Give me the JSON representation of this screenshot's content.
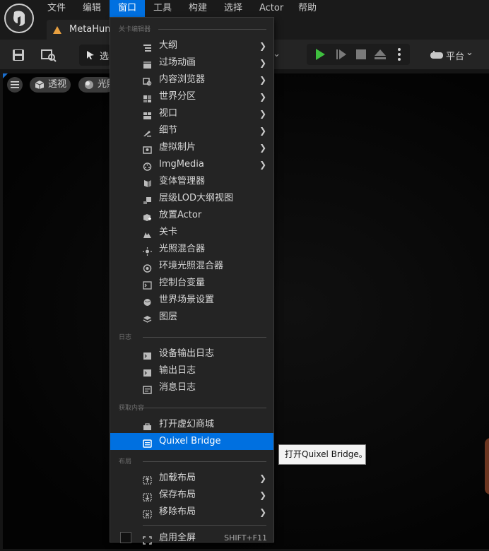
{
  "menubar": {
    "items": [
      "文件",
      "编辑",
      "窗口",
      "工具",
      "构建",
      "选择",
      "Actor",
      "帮助"
    ]
  },
  "document_tab": {
    "label": "MetaHuma"
  },
  "toolbar": {
    "select_mode_label": "选",
    "platform_label": "平台"
  },
  "viewport": {
    "perspective_label": "透视",
    "lighting_label": "光照"
  },
  "window_menu": {
    "sections": [
      {
        "title": "关卡编辑器",
        "items": [
          {
            "label": "大纲",
            "icon": "outliner-icon",
            "submenu": true
          },
          {
            "label": "过场动画",
            "icon": "cinematics-icon",
            "submenu": true
          },
          {
            "label": "内容浏览器",
            "icon": "content-browser-icon",
            "submenu": true
          },
          {
            "label": "世界分区",
            "icon": "world-partition-icon",
            "submenu": true
          },
          {
            "label": "视口",
            "icon": "viewport-icon",
            "submenu": true
          },
          {
            "label": "细节",
            "icon": "details-icon",
            "submenu": true
          },
          {
            "label": "虚拟制片",
            "icon": "virtual-production-icon",
            "submenu": true
          },
          {
            "label": "ImgMedia",
            "icon": "img-media-icon",
            "submenu": true
          },
          {
            "label": "变体管理器",
            "icon": "variant-manager-icon",
            "submenu": false
          },
          {
            "label": "层级LOD大纲视图",
            "icon": "hlod-outliner-icon",
            "submenu": false
          },
          {
            "label": "放置Actor",
            "icon": "place-actor-icon",
            "submenu": false
          },
          {
            "label": "关卡",
            "icon": "levels-icon",
            "submenu": false
          },
          {
            "label": "光照混合器",
            "icon": "light-mixer-icon",
            "submenu": false
          },
          {
            "label": "环境光照混合器",
            "icon": "env-light-mixer-icon",
            "submenu": false
          },
          {
            "label": "控制台变量",
            "icon": "console-variables-icon",
            "submenu": false
          },
          {
            "label": "世界场景设置",
            "icon": "world-settings-icon",
            "submenu": false
          },
          {
            "label": "图层",
            "icon": "layers-icon",
            "submenu": false
          }
        ]
      },
      {
        "title": "日志",
        "items": [
          {
            "label": "设备输出日志",
            "icon": "device-log-icon",
            "submenu": false
          },
          {
            "label": "输出日志",
            "icon": "output-log-icon",
            "submenu": false
          },
          {
            "label": "消息日志",
            "icon": "message-log-icon",
            "submenu": false
          }
        ]
      },
      {
        "title": "获取内容",
        "items": [
          {
            "label": "打开虚幻商城",
            "icon": "marketplace-icon",
            "submenu": false
          },
          {
            "label": "Quixel Bridge",
            "icon": "quixel-bridge-icon",
            "submenu": false,
            "highlighted": true
          }
        ]
      },
      {
        "title": "布局",
        "items": [
          {
            "label": "加载布局",
            "icon": "load-layout-icon",
            "submenu": true
          },
          {
            "label": "保存布局",
            "icon": "save-layout-icon",
            "submenu": true
          },
          {
            "label": "移除布局",
            "icon": "remove-layout-icon",
            "submenu": true
          }
        ]
      }
    ],
    "fullscreen": {
      "label": "启用全屏",
      "shortcut": "SHIFT+F11",
      "checked": false
    }
  },
  "tooltip": {
    "text": "打开Quixel Bridge。"
  },
  "colors": {
    "accent": "#0070e0",
    "play_green": "#3fbf3f"
  }
}
